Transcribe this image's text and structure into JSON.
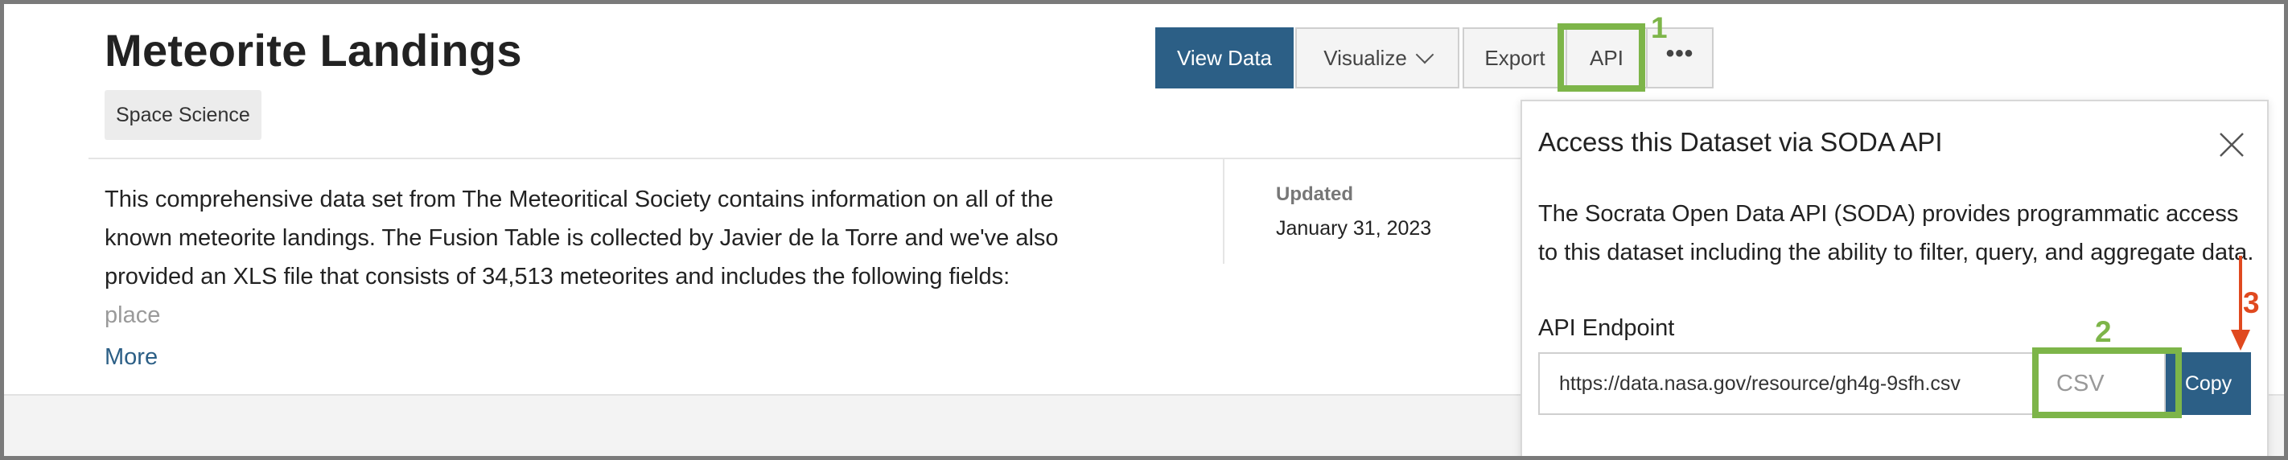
{
  "header": {
    "title": "Meteorite Landings",
    "category_tag": "Space Science"
  },
  "toolbar": {
    "view_data": "View Data",
    "visualize": "Visualize",
    "export": "Export",
    "api": "API",
    "more": "•••"
  },
  "description": {
    "lines": [
      "This comprehensive data set from The Meteoritical Society contains information on all of the",
      "known meteorite landings. The Fusion Table is collected by Javier de la Torre and we've also",
      "provided an XLS file that consists of 34,513 meteorites and includes the following fields:"
    ],
    "faded_line": "place",
    "more_link": "More"
  },
  "meta": {
    "updated_label": "Updated",
    "updated_value": "January 31, 2023"
  },
  "api_popup": {
    "title": "Access this Dataset via SODA API",
    "description": "The Socrata Open Data API (SODA) provides programmatic access to this dataset including the ability to filter, query, and aggregate data.",
    "endpoint_label": "API Endpoint",
    "endpoint_url": "https://data.nasa.gov/resource/gh4g-9sfh.csv",
    "format_value": "CSV",
    "copy_label": "Copy"
  },
  "annotations": {
    "step_1": "1",
    "step_2": "2",
    "step_3": "3",
    "highlight_color": "#7db549",
    "arrow_color": "#e0491f"
  },
  "colors": {
    "primary": "#2c5f86"
  }
}
